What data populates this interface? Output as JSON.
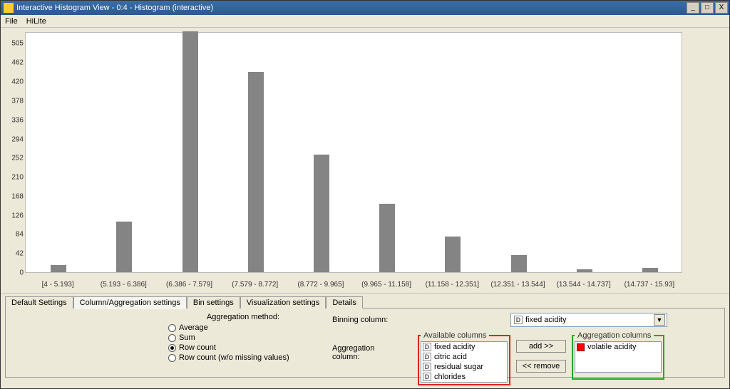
{
  "window": {
    "title": "Interactive Histogram View - 0:4 - Histogram (interactive)"
  },
  "menu": {
    "file": "File",
    "hilite": "HiLite"
  },
  "titlebar_buttons": {
    "minimize": "_",
    "maximize": "□",
    "close": "X"
  },
  "tabs": {
    "default": "Default Settings",
    "colagg": "Column/Aggregation settings",
    "bin": "Bin settings",
    "viz": "Visualization settings",
    "details": "Details"
  },
  "settings": {
    "aggregation_method_label": "Aggregation method:",
    "radios": {
      "average": "Average",
      "sum": "Sum",
      "rowcount": "Row count",
      "rowcount_no_missing": "Row count (w/o missing values)"
    },
    "binning_col_label": "Binning column:",
    "aggregation_col_label": "Aggregation column:",
    "binning_value": "fixed acidity",
    "available_legend": "Available columns",
    "available_items": [
      "fixed acidity",
      "citric acid",
      "residual sugar",
      "chlorides"
    ],
    "aggregation_legend": "Aggregation columns",
    "aggregation_items": [
      "volatile acidity"
    ],
    "add_btn": "add >>",
    "remove_btn": "<< remove"
  },
  "chart_data": {
    "type": "bar",
    "categories": [
      "[4 - 5.193]",
      "(5.193 - 6.386]",
      "(6.386 - 7.579]",
      "(7.579 - 8.772]",
      "(8.772 - 9.965]",
      "(9.965 - 11.158]",
      "(11.158 - 12.351]",
      "(12.351 - 13.544]",
      "(13.544 - 14.737]",
      "(14.737 - 15.93]"
    ],
    "values": [
      15,
      111,
      530,
      440,
      259,
      150,
      78,
      38,
      6,
      9
    ],
    "title": "",
    "xlabel": "",
    "ylabel": "",
    "ymax": 530,
    "yticks": [
      505,
      462,
      420,
      378,
      336,
      294,
      252,
      210,
      168,
      126,
      84,
      42,
      0
    ]
  }
}
